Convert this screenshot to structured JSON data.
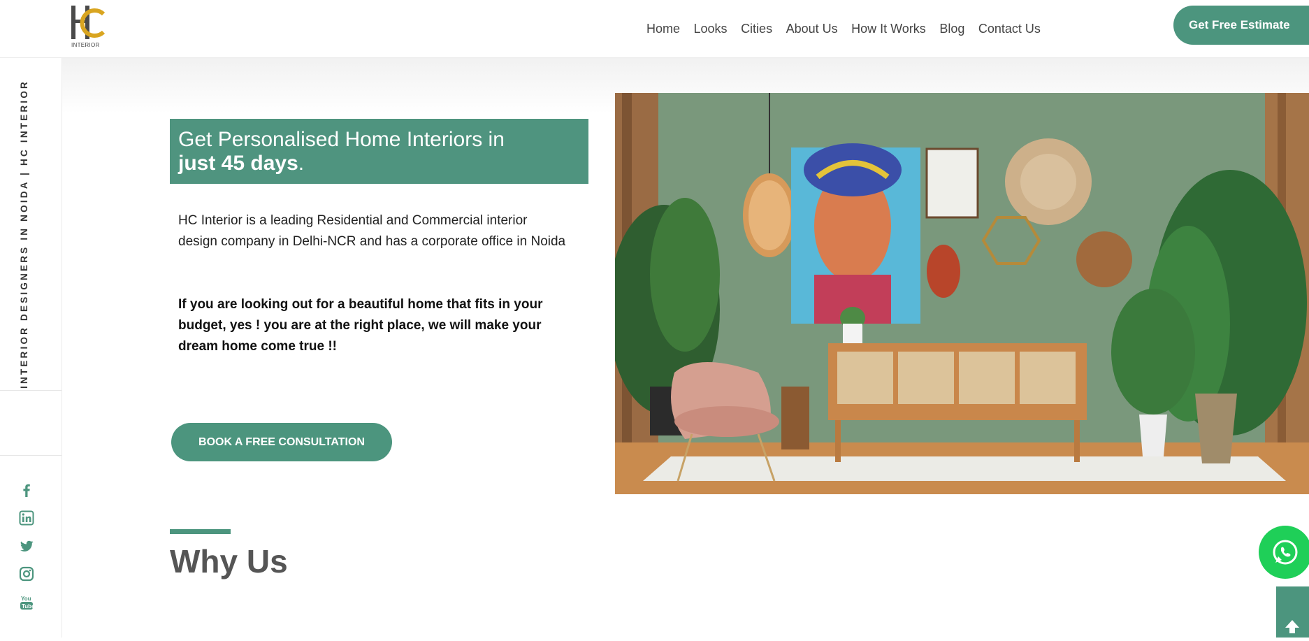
{
  "brand": {
    "logo_letters": "HC",
    "logo_sub": "INTERIOR"
  },
  "nav": {
    "items": [
      {
        "label": "Home"
      },
      {
        "label": "Looks"
      },
      {
        "label": "Cities"
      },
      {
        "label": "About Us"
      },
      {
        "label": "How It Works"
      },
      {
        "label": "Blog"
      },
      {
        "label": "Contact Us"
      }
    ],
    "estimate_label": "Get Free Estimate"
  },
  "sidebar": {
    "vertical_text": "INTERIOR DESIGNERS IN NOIDA | HC INTERIOR",
    "social_icons": [
      "facebook-icon",
      "linkedin-icon",
      "twitter-icon",
      "instagram-icon",
      "youtube-icon"
    ]
  },
  "hero": {
    "title_line1": "Get Personalised Home Interiors in",
    "title_bold": "just 45 days",
    "title_end": ".",
    "description": "HC Interior is a leading Residential and Commercial interior design company in Delhi-NCR and has a corporate office in Noida",
    "pitch": "If you are looking out for a beautiful home that fits in your budget, yes ! you are at the right place, we will make your dream home come true !!",
    "cta_label": "BOOK A FREE CONSULTATION"
  },
  "why": {
    "title": "Why Us"
  },
  "colors": {
    "accent": "#4c957e",
    "logo_gold": "#d9a520",
    "logo_gray": "#4a4a4a",
    "whatsapp": "#1fcf58"
  }
}
